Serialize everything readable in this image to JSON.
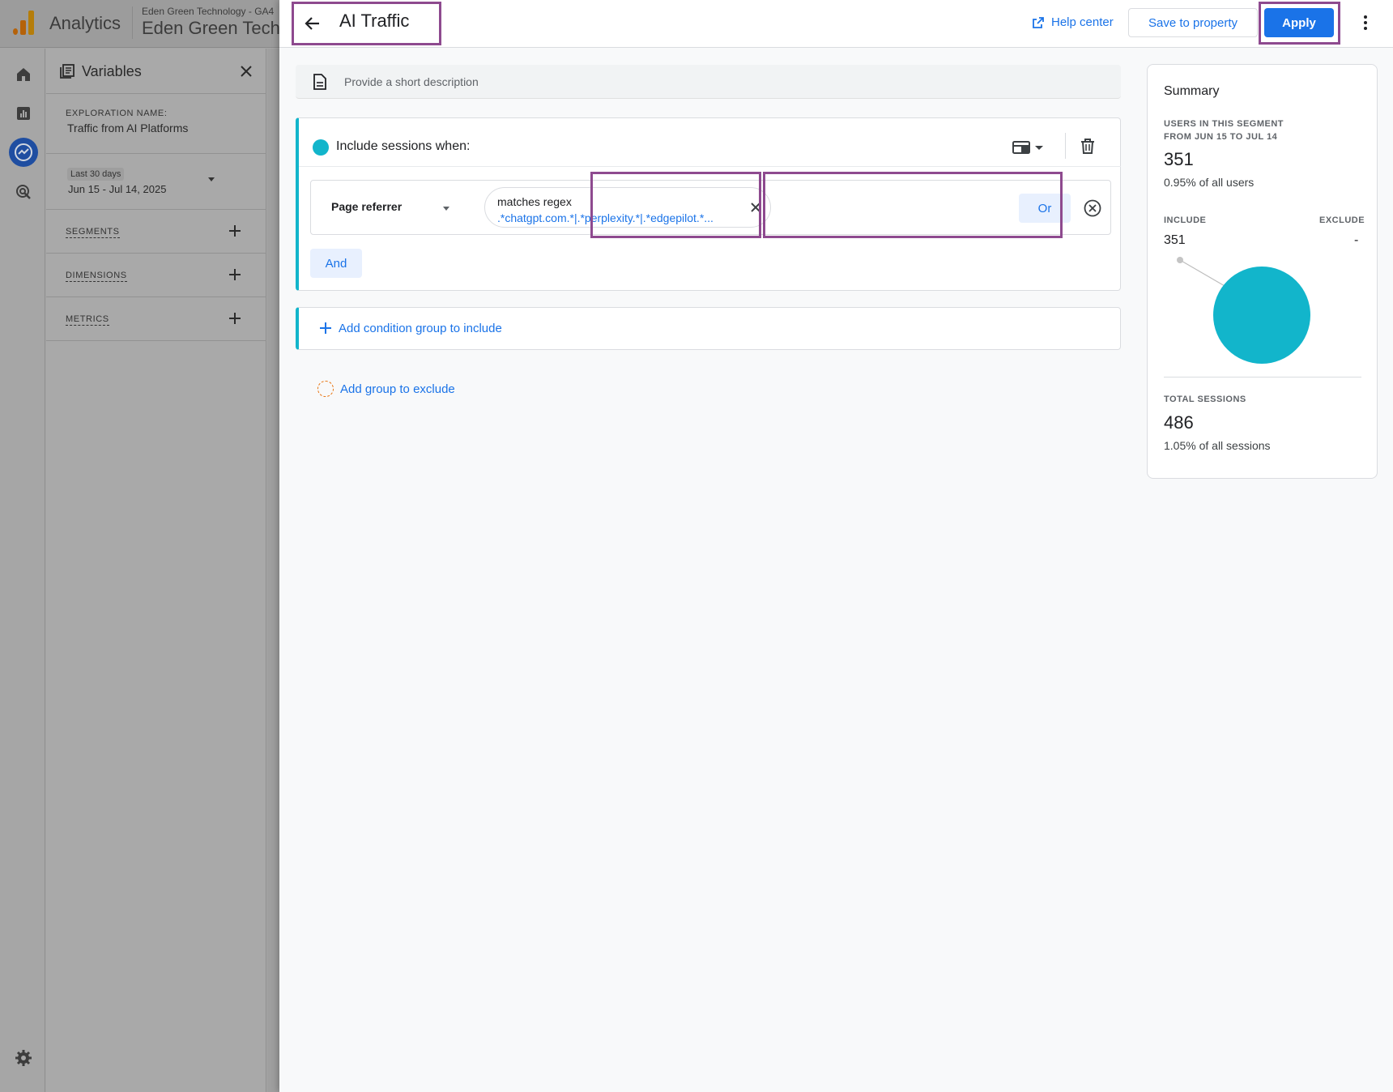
{
  "background": {
    "app_name": "Analytics",
    "account_name": "Eden Green Technology - GA4",
    "property_name": "Eden Green Technology",
    "variables": {
      "title": "Variables",
      "exploration_label": "EXPLORATION NAME:",
      "exploration_name": "Traffic from AI Platforms",
      "date_chip": "Last 30 days",
      "date_range": "Jun 15 - Jul 14, 2025",
      "segments_label": "SEGMENTS",
      "dimensions_label": "DIMENSIONS",
      "metrics_label": "METRICS"
    }
  },
  "header": {
    "title": "AI Traffic",
    "help_label": "Help center",
    "save_label": "Save to property",
    "apply_label": "Apply"
  },
  "description": {
    "placeholder": "Provide a short description"
  },
  "include_group": {
    "label": "Include sessions when:",
    "condition": {
      "dimension": "Page referrer",
      "operator": "matches regex",
      "value": ".*chatgpt.com.*|.*perplexity.*|.*edgepilot.*..."
    },
    "or_label": "Or",
    "and_label": "And"
  },
  "add_include_label": "Add condition group to include",
  "add_exclude_label": "Add group to exclude",
  "summary": {
    "title": "Summary",
    "users_label_line1": "USERS IN THIS SEGMENT",
    "users_label_line2": "FROM JUN 15 TO JUL 14",
    "users_value": "351",
    "users_pct": "0.95% of all users",
    "include_label": "INCLUDE",
    "exclude_label": "EXCLUDE",
    "include_value": "351",
    "exclude_value": "-",
    "sessions_label": "TOTAL SESSIONS",
    "sessions_value": "486",
    "sessions_pct": "1.05% of all sessions"
  },
  "colors": {
    "accent": "#1a73e8",
    "segment": "#12b5cb",
    "highlight": "#8e4a8f",
    "exclude": "#e8710a"
  }
}
